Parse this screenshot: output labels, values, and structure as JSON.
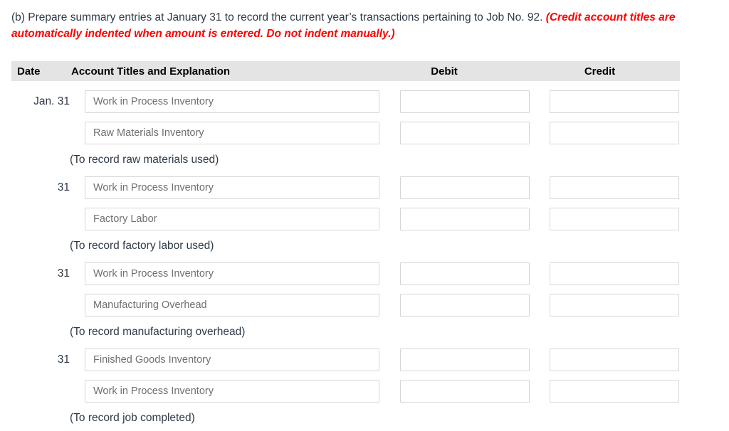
{
  "instructions": {
    "main": "(b) Prepare summary entries at January 31 to record the current year’s transactions pertaining to Job No. 92.",
    "note": "(Credit account titles are automatically indented when amount is entered. Do not indent manually.)"
  },
  "table": {
    "headers": {
      "date": "Date",
      "account": "Account Titles and Explanation",
      "debit": "Debit",
      "credit": "Credit"
    },
    "entries": [
      {
        "date": "Jan. 31",
        "lines": [
          {
            "account": "Work in Process Inventory",
            "debit": "",
            "credit": ""
          },
          {
            "account": "Raw Materials Inventory",
            "debit": "",
            "credit": ""
          }
        ],
        "explanation": "(To record raw materials used)"
      },
      {
        "date": "31",
        "lines": [
          {
            "account": "Work in Process Inventory",
            "debit": "",
            "credit": ""
          },
          {
            "account": "Factory Labor",
            "debit": "",
            "credit": ""
          }
        ],
        "explanation": "(To record factory labor used)"
      },
      {
        "date": "31",
        "lines": [
          {
            "account": "Work in Process Inventory",
            "debit": "",
            "credit": ""
          },
          {
            "account": "Manufacturing Overhead",
            "debit": "",
            "credit": ""
          }
        ],
        "explanation": "(To record manufacturing overhead)"
      },
      {
        "date": "31",
        "lines": [
          {
            "account": "Finished Goods Inventory",
            "debit": "",
            "credit": ""
          },
          {
            "account": "Work in Process Inventory",
            "debit": "",
            "credit": ""
          }
        ],
        "explanation": "(To record job completed)"
      }
    ]
  },
  "colors": {
    "note_red": "#ff0000",
    "header_band": "#e4e4e4",
    "field_border": "#d6d6d6",
    "text_dark": "#2f3a47",
    "field_text": "#6f6f6f"
  }
}
